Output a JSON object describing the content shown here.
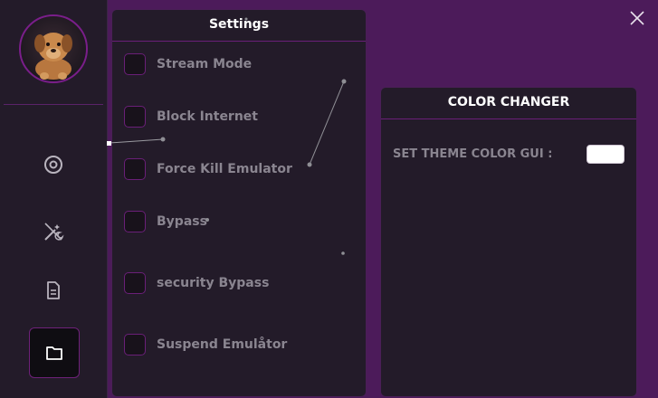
{
  "sidebar": {
    "avatar_icon": "dog-icon",
    "nav": [
      {
        "icon": "target-icon",
        "active": false
      },
      {
        "icon": "magic-wand-icon",
        "active": false
      },
      {
        "icon": "document-icon",
        "active": false
      },
      {
        "icon": "folder-icon",
        "active": true
      }
    ]
  },
  "settings": {
    "title": "Settings",
    "options": [
      {
        "label": "Stream Mode"
      },
      {
        "label": "Block Internet"
      },
      {
        "label": "Force Kill Emulator"
      },
      {
        "label": "Bypass"
      },
      {
        "label": "security Bypass"
      },
      {
        "label": "Suspend Emulåtor"
      }
    ]
  },
  "color_changer": {
    "title": "COLOR CHANGER",
    "theme_label": "SET THEME COLOR GUI :",
    "swatch_color": "#ffffff"
  },
  "colors": {
    "background": "#4c1b5a",
    "panel": "#231b29",
    "accent": "#6a1f78"
  }
}
